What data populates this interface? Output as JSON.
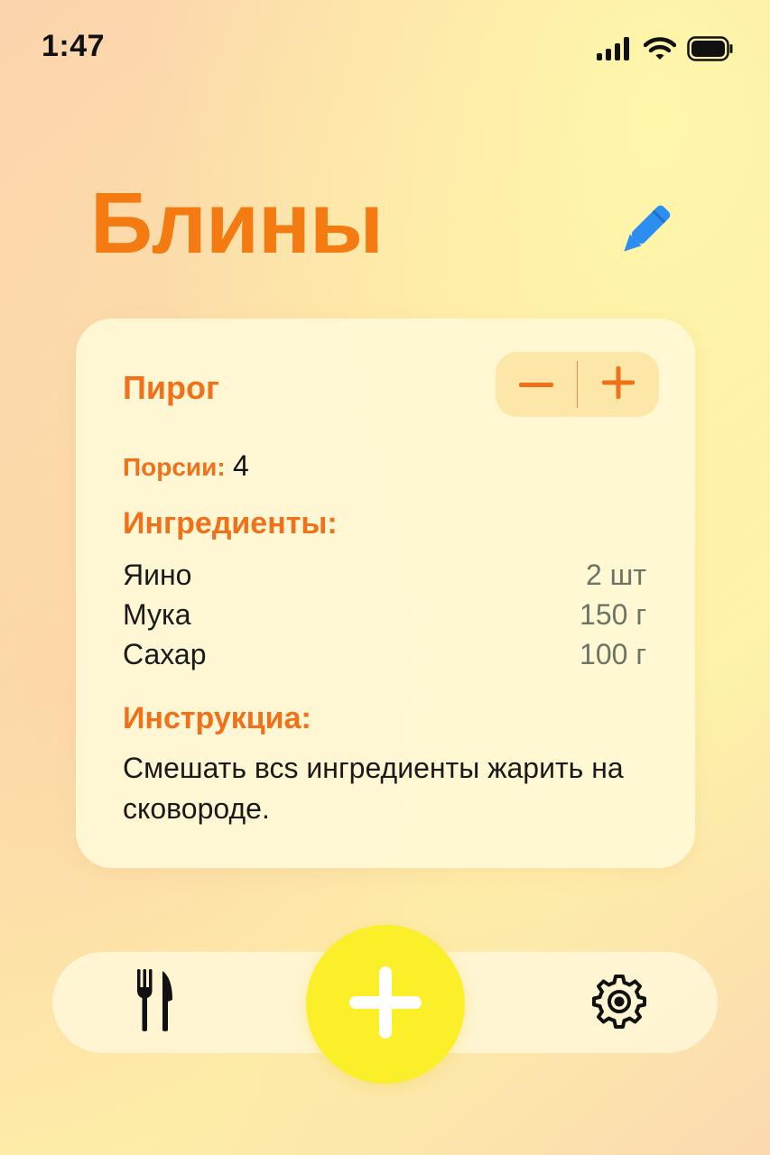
{
  "status_bar": {
    "time": "1:47",
    "icons": [
      "cellular-signal-icon",
      "wifi-icon",
      "battery-icon"
    ]
  },
  "header": {
    "title": "Блины",
    "edit_icon": "pencil-icon"
  },
  "recipe_card": {
    "name": "Пирог",
    "stepper": {
      "decrement_label": "−",
      "increment_label": "+"
    },
    "servings_label": "Порсии:",
    "servings_value": "4",
    "ingredients_title": "Ингредиенты:",
    "ingredients": [
      {
        "name": "Яино",
        "quantity": "2 шт"
      },
      {
        "name": "Мука",
        "quantity": "150 г"
      },
      {
        "name": "Сахар",
        "quantity": "100 г"
      }
    ],
    "instructions_title": "Инструкциа:",
    "instructions_text": "Смешать всs ингредиенты жарить на сковороде."
  },
  "bottom_nav": {
    "items": [
      {
        "icon": "fork-knife-icon"
      },
      {
        "icon": "plus-icon"
      },
      {
        "icon": "gear-icon"
      }
    ]
  },
  "colors": {
    "accent": "#f47a12",
    "edit_icon": "#2b8ef0",
    "add_button": "#fbef2a",
    "quantity_text": "#6b7466"
  }
}
